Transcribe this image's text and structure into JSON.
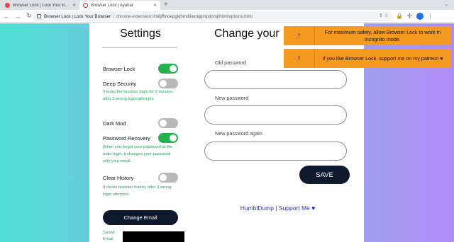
{
  "browser": {
    "tabs": [
      {
        "title": "Browser Lock | Lock Your Browser",
        "favicon_color": "#e8453c",
        "active": false
      },
      {
        "title": "Browser Lock | Ayarlar",
        "favicon_color": "#d93025",
        "active": true
      }
    ],
    "new_tab": "+",
    "tab_list": "⌄",
    "nav": {
      "back": "←",
      "forward": "→",
      "reload": "↻"
    },
    "omnibox": {
      "site": "Browser Lock | Lock Your Browser",
      "separator": "|",
      "url": "chrome-extension://nldjffmoepgkjhmdiiainkjgmpdnmj/html/options.html"
    }
  },
  "settings": {
    "title": "Settings",
    "toggles": [
      {
        "label": "Browser Lock",
        "state": "on"
      },
      {
        "label": "Deep Security",
        "state": "off",
        "hint": "It locks the browser login for 3 minutes after 3 wrong login attempts."
      },
      {
        "label": "Dark Mod",
        "state": "off"
      },
      {
        "label": "Password Recovery",
        "state": "on",
        "hint": "When you forgot your password at the main login, it changes your password with your email."
      },
      {
        "label": "Clear History",
        "state": "off",
        "hint": "It clears browser history after 3 wrong login attempts."
      }
    ],
    "change_email_label": "Change Email",
    "saved_email_label": "Saved Email"
  },
  "password": {
    "title": "Change your",
    "old_label": "Old password",
    "new_label": "New password",
    "again_label": "New password again",
    "save_label": "SAVE",
    "support_text": "HumblDump | Support Me",
    "heart": "♥"
  },
  "toasts": [
    {
      "icon": "!",
      "message": "For maximum safety, allow Browser Lock to work in incognito mode."
    },
    {
      "icon": "!",
      "message": "If you like Browser Lock, support me on my patreon ♥"
    }
  ],
  "colors": {
    "toggle_on": "#22b14c",
    "toggle_off": "#b8b8b8",
    "hint_text": "#22a35a",
    "button_dark": "#0e1a2b",
    "toast": "#f59a1e"
  }
}
